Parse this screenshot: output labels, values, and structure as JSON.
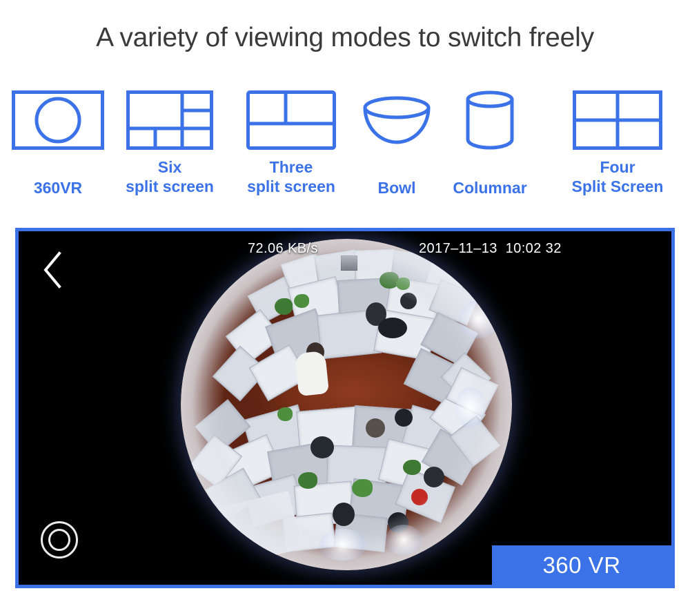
{
  "header": {
    "title": "A variety of viewing modes to switch freely"
  },
  "mode_bar": {
    "accent_color": "#3b72e8",
    "items": [
      {
        "label": "360VR",
        "icon": "rect-with-circle-icon",
        "mode_id": "360vr"
      },
      {
        "label": "Six\nsplit screen",
        "icon": "six-split-grid-icon",
        "mode_id": "six-split"
      },
      {
        "label": "Three\nsplit screen",
        "icon": "three-split-grid-icon",
        "mode_id": "three-split"
      },
      {
        "label": "Bowl",
        "icon": "bowl-hemisphere-icon",
        "mode_id": "bowl"
      },
      {
        "label": "Columnar",
        "icon": "cylinder-icon",
        "mode_id": "columnar"
      },
      {
        "label": "Four\nSplit Screen",
        "icon": "four-split-grid-icon",
        "mode_id": "four-split"
      }
    ]
  },
  "video": {
    "border_color": "#3b72e8",
    "background_color": "#000000",
    "osd": {
      "bitrate": "72.06 KB/s",
      "datetime": "2017–11–13  10:02 32"
    },
    "controls": {
      "back_icon": "chevron-left-icon",
      "capture_icon": "capture-ring-icon"
    },
    "badge": {
      "label": "360 VR",
      "background_color": "#3b72e8",
      "text_color": "#ffffff"
    }
  }
}
